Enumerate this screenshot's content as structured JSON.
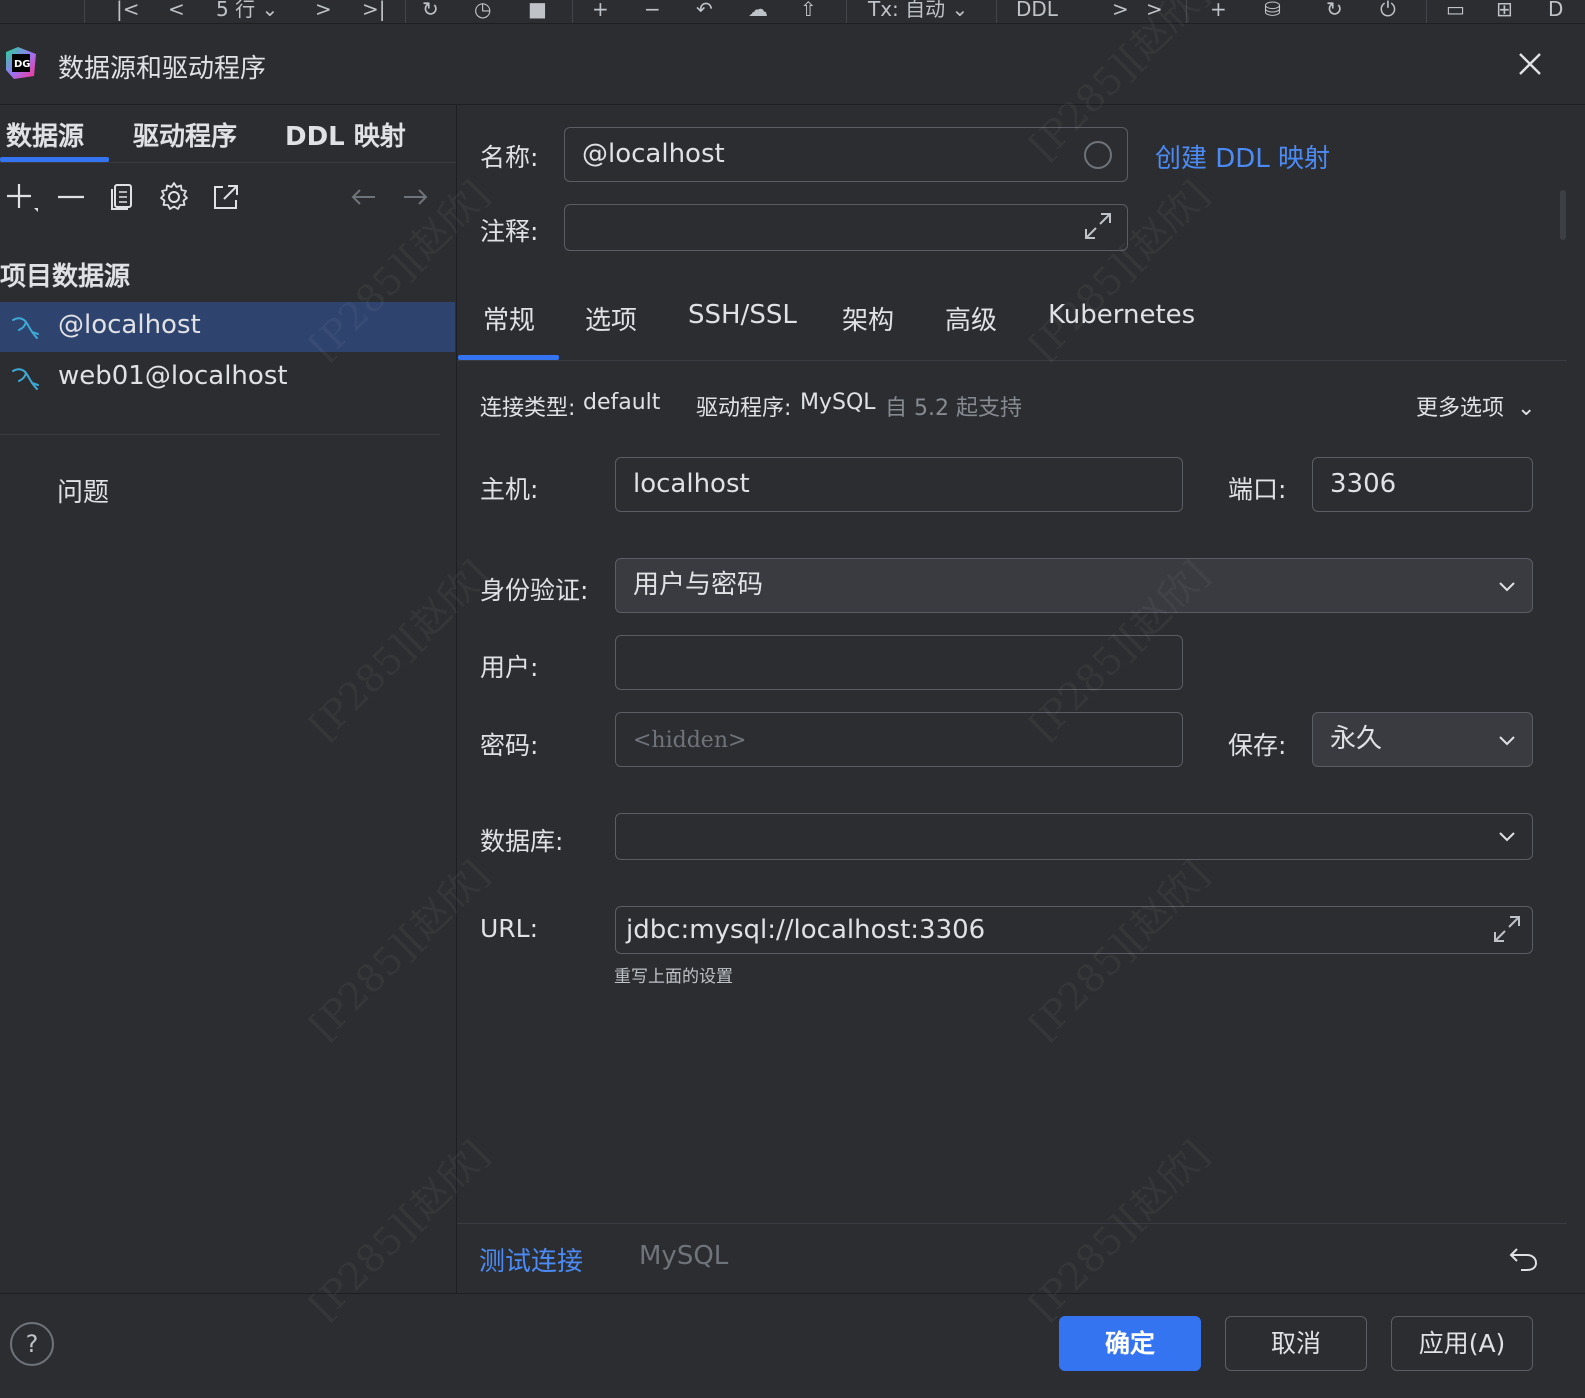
{
  "toolbar": {
    "rows_label": "5 行",
    "tx_label": "Tx: 自动",
    "ddl_label": "DDL",
    "edge_label": "D"
  },
  "dialog": {
    "title": "数据源和驱动程序"
  },
  "left": {
    "tabs": [
      "数据源",
      "驱动程序",
      "DDL 映射"
    ],
    "active_tab": 0,
    "section_title": "项目数据源",
    "datasources": [
      {
        "label": "@localhost",
        "selected": true,
        "icon": "mysql-dolphin-icon"
      },
      {
        "label": "web01@localhost",
        "selected": false,
        "icon": "mysql-dolphin-icon"
      }
    ],
    "problems_label": "问题"
  },
  "right": {
    "name_label": "名称:",
    "name_value": "@localhost",
    "create_ddl_link": "创建 DDL 映射",
    "comment_label": "注释:",
    "comment_value": "",
    "tabs": [
      "常规",
      "选项",
      "SSH/SSL",
      "架构",
      "高级",
      "Kubernetes"
    ],
    "active_tab": 0,
    "conn_type_label": "连接类型:",
    "conn_type_value": "default",
    "driver_label": "驱动程序:",
    "driver_value": "MySQL",
    "driver_support": "自 5.2 起支持",
    "more_options": "更多选项",
    "host_label": "主机:",
    "host_value": "localhost",
    "port_label": "端口:",
    "port_value": "3306",
    "auth_label": "身份验证:",
    "auth_value": "用户与密码",
    "user_label": "用户:",
    "user_value": "",
    "password_label": "密码:",
    "password_placeholder": "<hidden>",
    "save_label": "保存:",
    "save_value": "永久",
    "database_label": "数据库:",
    "database_value": "",
    "url_label": "URL:",
    "url_value": "jdbc:mysql://localhost:3306",
    "url_hint": "重写上面的设置",
    "test_connection": "测试连接",
    "footer_driver": "MySQL"
  },
  "footer": {
    "help": "?",
    "ok": "确定",
    "cancel": "取消",
    "apply": "应用(A)"
  },
  "watermark": "[P285][赵欣]",
  "colors": {
    "background": "#2b2d30",
    "selection": "#2e436e",
    "accent": "#3574f0",
    "link": "#4c8bf5",
    "border": "#5a5d63"
  }
}
